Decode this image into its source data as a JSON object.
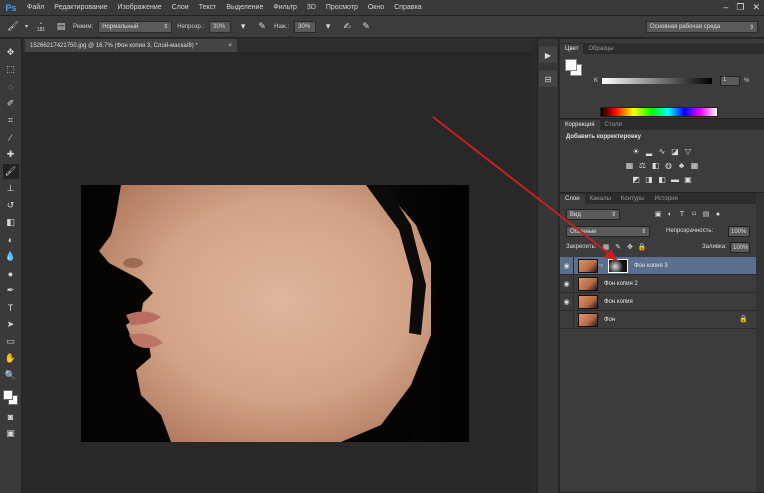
{
  "app": {
    "logo": "Ps"
  },
  "menu": [
    "Файл",
    "Редактирование",
    "Изображение",
    "Слои",
    "Текст",
    "Выделение",
    "Фильтр",
    "3D",
    "Просмотр",
    "Окно",
    "Справка"
  ],
  "window_controls": {
    "minimize": "–",
    "restore": "❐",
    "close": "✕"
  },
  "options": {
    "brush_size": "181",
    "mode_label": "Режим:",
    "mode_value": "Нормальный",
    "opacity_label": "Непрозр.:",
    "opacity_value": "30%",
    "flow_label": "Наж.:",
    "flow_value": "30%",
    "workspace": "Основная рабочая среда"
  },
  "document": {
    "tab_title": "15266217421750.jpg @ 16.7% (Фон копия 3, Слой-маска/8) *",
    "tab_close": "×"
  },
  "color_panel": {
    "tabs": [
      "Цвет",
      "Образцы"
    ],
    "k_label": "K",
    "k_value": "1",
    "k_unit": "%"
  },
  "adjustments_panel": {
    "tabs": [
      "Коррекция",
      "Стили"
    ],
    "title": "Добавить корректировку"
  },
  "layers_panel": {
    "tabs": [
      "Слои",
      "Каналы",
      "Контуры",
      "История"
    ],
    "filter": "Вид",
    "blend_mode": "Обычные",
    "opacity_label": "Непрозрачность:",
    "opacity_value": "100%",
    "lock_label": "Закрепить:",
    "fill_label": "Заливка:",
    "fill_value": "100%",
    "layers": [
      {
        "name": "Фон копия 3",
        "visible": true,
        "selected": true,
        "has_mask": true
      },
      {
        "name": "Фон копия 2",
        "visible": true,
        "selected": false,
        "has_mask": false
      },
      {
        "name": "Фон копия",
        "visible": true,
        "selected": false,
        "has_mask": false
      },
      {
        "name": "Фон",
        "visible": false,
        "selected": false,
        "has_mask": false,
        "locked": true
      }
    ]
  },
  "colors": {
    "accent": "#31a8ff",
    "selected_layer": "#5b6f8e",
    "annotation_arrow": "#c8201e"
  }
}
